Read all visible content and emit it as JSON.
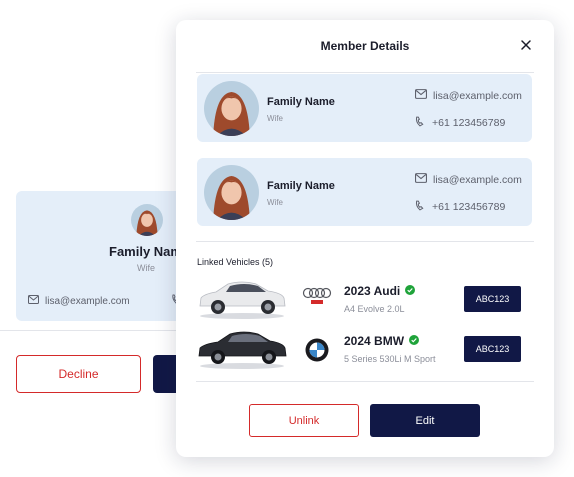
{
  "background": {
    "card": {
      "name": "Family Nam",
      "role": "Wife",
      "email": "lisa@example.com"
    },
    "decline_label": "Decline"
  },
  "modal": {
    "title": "Member Details",
    "close_icon": "close-icon",
    "members": [
      {
        "name": "Family Name",
        "role": "Wife",
        "email": "lisa@example.com",
        "phone": "+61 123456789"
      },
      {
        "name": "Family Name",
        "role": "Wife",
        "email": "lisa@example.com",
        "phone": "+61 123456789"
      }
    ],
    "linked_vehicles_label": "Linked Vehicles (5)",
    "vehicles": [
      {
        "title": "2023 Audi",
        "subtitle": "A4 Evolve 2.0L",
        "plate": "ABC123",
        "brand": "Audi",
        "car_color": "#e9eaec"
      },
      {
        "title": "2024 BMW",
        "subtitle": "5 Series 530Li M Sport",
        "plate": "ABC123",
        "brand": "BMW",
        "car_color": "#2b2d33"
      }
    ],
    "unlink_label": "Unlink",
    "edit_label": "Edit"
  },
  "colors": {
    "card_bg": "#e4eef9",
    "primary_navy": "#111846",
    "danger_red": "#d42a2a",
    "verified_green": "#1fa33a"
  }
}
